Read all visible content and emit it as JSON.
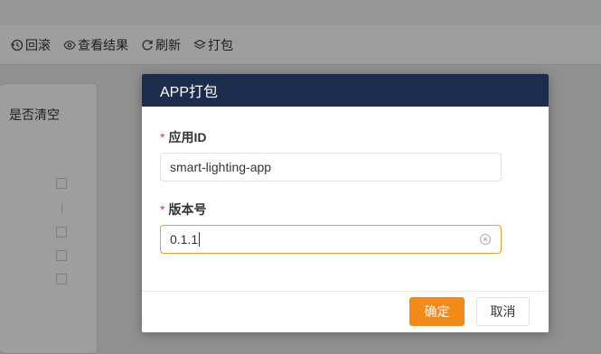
{
  "toolbar": {
    "rollback": "回滚",
    "view_result": "查看结果",
    "refresh": "刷新",
    "package": "打包"
  },
  "left_panel": {
    "column_header": "是否清空"
  },
  "dialog": {
    "title": "APP打包",
    "fields": [
      {
        "label": "应用ID",
        "required": "*",
        "value": "smart-lighting-app"
      },
      {
        "label": "版本号",
        "required": "*",
        "value": "0.1.1"
      }
    ],
    "confirm_label": "确定",
    "cancel_label": "取消"
  },
  "colors": {
    "header_bg": "#1c2c4c",
    "primary": "#f38a17",
    "required": "#e4393c"
  },
  "icons": [
    "history-icon",
    "eye-icon",
    "refresh-icon",
    "layers-icon",
    "clear-circle-icon"
  ]
}
